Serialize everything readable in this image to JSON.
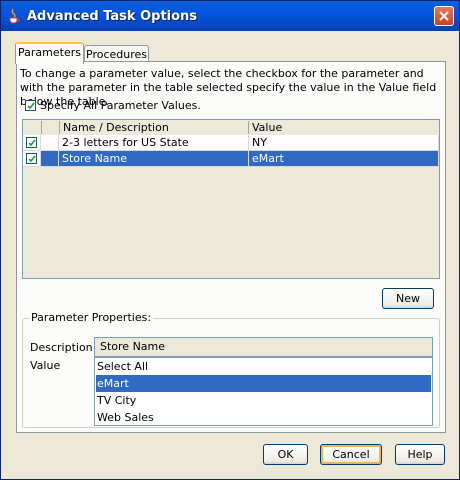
{
  "window": {
    "title": "Advanced Task Options"
  },
  "tabs": [
    {
      "label": "Parameters",
      "active": true
    },
    {
      "label": "Procedures",
      "active": false
    }
  ],
  "instructions": "To change a parameter value, select the checkbox for the parameter and with the parameter in the table selected specify the value in the Value field below the table.",
  "specify_all": {
    "label": "Specify All Parameter Values.",
    "checked": true
  },
  "table": {
    "columns": [
      "Name / Description",
      "Value"
    ],
    "rows": [
      {
        "checked": true,
        "name": "2-3 letters for US State",
        "value": "NY",
        "selected": false
      },
      {
        "checked": true,
        "name": "Store Name",
        "value": "eMart",
        "selected": true
      }
    ]
  },
  "new_button": "New",
  "parameter_properties": {
    "legend": "Parameter Properties:",
    "description_label": "Description",
    "description_value": "Store Name",
    "value_label": "Value",
    "options": [
      "Select All",
      "eMart",
      "TV City",
      "Web Sales"
    ],
    "selected_option": "eMart"
  },
  "buttons": {
    "ok": "OK",
    "cancel": "Cancel",
    "help": "Help"
  },
  "colors": {
    "titlebar": "#0454E0",
    "selection": "#316AC5",
    "dialog_bg": "#ECE9D8"
  },
  "icons": {
    "app": "java-cup-icon",
    "close": "close-icon",
    "check": "checkmark-icon"
  }
}
